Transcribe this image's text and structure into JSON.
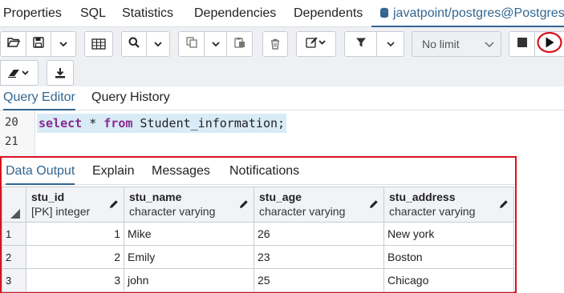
{
  "tabs": [
    {
      "label": "Properties"
    },
    {
      "label": "SQL"
    },
    {
      "label": "Statistics"
    },
    {
      "label": "Dependencies"
    },
    {
      "label": "Dependents"
    },
    {
      "label": "javatpoint/postgres@Postgres"
    }
  ],
  "toolbar": {
    "limit_label": "No limit",
    "icons": [
      "open-file-icon",
      "save-icon",
      "save-dropdown-icon",
      "grid-icon",
      "search-icon",
      "search-dropdown-icon",
      "copy-icon",
      "copy-dropdown-icon",
      "paste-icon",
      "delete-icon",
      "edit-icon",
      "filter-icon",
      "filter-dropdown-icon",
      "limit-dropdown-icon",
      "stop-icon",
      "execute-icon",
      "eraser-icon",
      "download-icon"
    ]
  },
  "editor_tabs": [
    {
      "label": "Query Editor"
    },
    {
      "label": "Query History"
    }
  ],
  "code": {
    "lines": [
      {
        "num": "20"
      },
      {
        "num": "21"
      }
    ],
    "kw1": "select",
    "op": " * ",
    "kw2": "from",
    "rest": " Student_information;"
  },
  "results": {
    "tabs": [
      {
        "label": "Data Output"
      },
      {
        "label": "Explain"
      },
      {
        "label": "Messages"
      },
      {
        "label": "Notifications"
      }
    ],
    "columns": [
      {
        "name": "stu_id",
        "type": "[PK] integer"
      },
      {
        "name": "stu_name",
        "type": "character varying"
      },
      {
        "name": "stu_age",
        "type": "character varying"
      },
      {
        "name": "stu_address",
        "type": "character varying"
      }
    ],
    "rows": [
      {
        "n": "1",
        "id": "1",
        "name": "Mike",
        "age": "26",
        "address": "New york"
      },
      {
        "n": "2",
        "id": "2",
        "name": "Emily",
        "age": "23",
        "address": "Boston"
      },
      {
        "n": "3",
        "id": "3",
        "name": "john",
        "age": "25",
        "address": "Chicago"
      }
    ]
  },
  "colors": {
    "accent": "#326690",
    "highlight_border": "#d7141e",
    "keyword": "#8a2b8b"
  }
}
